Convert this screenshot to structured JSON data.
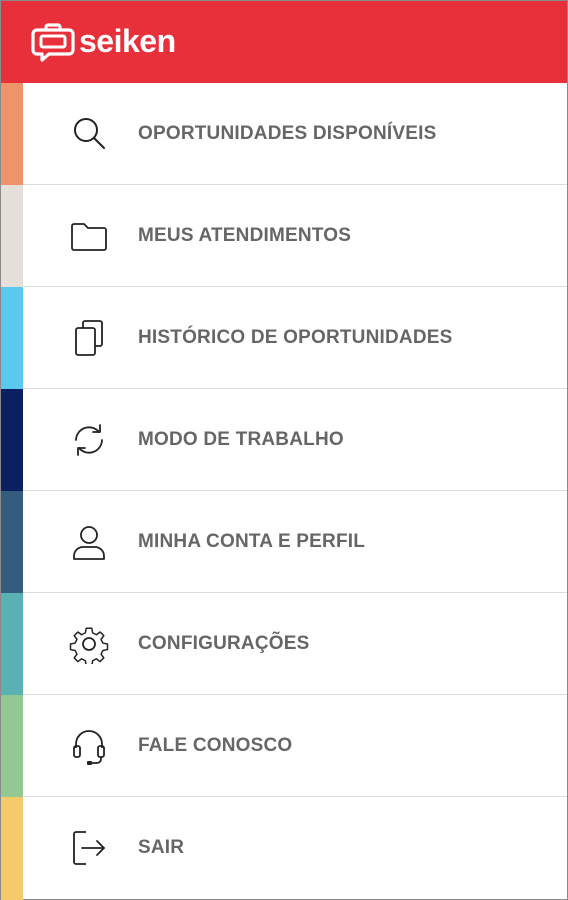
{
  "header": {
    "brand_name": "seiken",
    "logo_icon": "briefcase-chat-icon",
    "background_color": "#e8303b"
  },
  "menu": {
    "items": [
      {
        "label": "OPORTUNIDADES DISPONÍVEIS",
        "icon": "search-icon",
        "strip_color": "#ef946a"
      },
      {
        "label": "MEUS ATENDIMENTOS",
        "icon": "folder-icon",
        "strip_color": "#e5dfd9"
      },
      {
        "label": "HISTÓRICO DE OPORTUNIDADES",
        "icon": "copy-icon",
        "strip_color": "#5bc8ef"
      },
      {
        "label": "MODO DE TRABALHO",
        "icon": "refresh-icon",
        "strip_color": "#0b2060"
      },
      {
        "label": "MINHA CONTA E PERFIL",
        "icon": "user-icon",
        "strip_color": "#335c7e"
      },
      {
        "label": "CONFIGURAÇÕES",
        "icon": "gear-icon",
        "strip_color": "#59b1b3"
      },
      {
        "label": "FALE CONOSCO",
        "icon": "headset-icon",
        "strip_color": "#93c893"
      },
      {
        "label": "SAIR",
        "icon": "logout-icon",
        "strip_color": "#f6c96a"
      }
    ]
  }
}
